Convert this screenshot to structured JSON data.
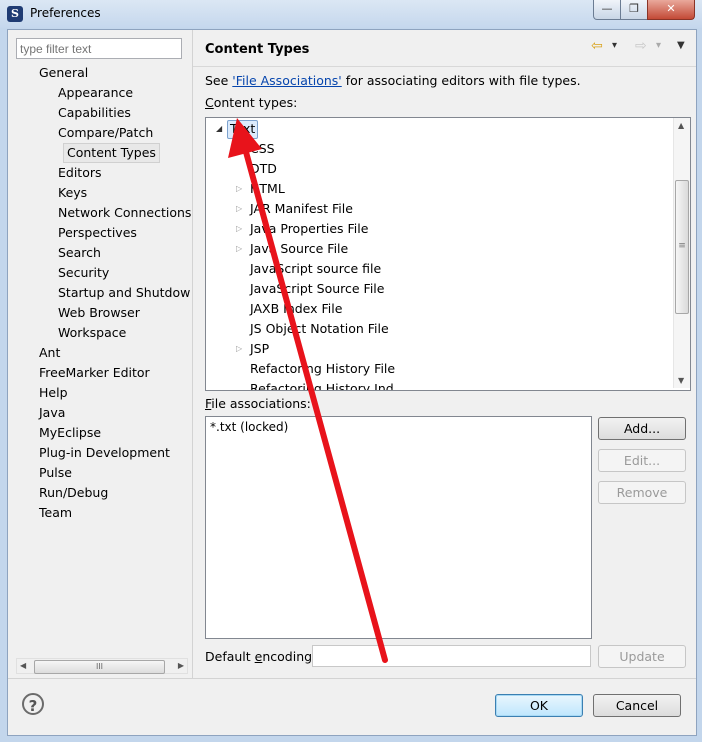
{
  "window": {
    "title": "Preferences",
    "min": "—",
    "max": "❐",
    "close": "✕",
    "app_icon": "S"
  },
  "filter": {
    "placeholder": "type filter text"
  },
  "nav_tree": [
    {
      "label": "General"
    },
    {
      "label": "Appearance"
    },
    {
      "label": "Capabilities"
    },
    {
      "label": "Compare/Patch"
    },
    {
      "label": "Content Types",
      "selected": true
    },
    {
      "label": "Editors"
    },
    {
      "label": "Keys"
    },
    {
      "label": "Network Connections"
    },
    {
      "label": "Perspectives"
    },
    {
      "label": "Search"
    },
    {
      "label": "Security"
    },
    {
      "label": "Startup and Shutdow"
    },
    {
      "label": "Web Browser"
    },
    {
      "label": "Workspace"
    },
    {
      "label": "Ant"
    },
    {
      "label": "FreeMarker Editor"
    },
    {
      "label": "Help"
    },
    {
      "label": "Java"
    },
    {
      "label": "MyEclipse"
    },
    {
      "label": "Plug-in Development"
    },
    {
      "label": "Pulse"
    },
    {
      "label": "Run/Debug"
    },
    {
      "label": "Team"
    }
  ],
  "hscroll_grip": "III",
  "page": {
    "title": "Content Types",
    "desc_prefix": "See ",
    "desc_link": "'File Associations'",
    "desc_suffix": " for associating editors with file types.",
    "content_types_label_u": "C",
    "content_types_label_rest": "ontent types:",
    "content_types": [
      {
        "label": "Text",
        "selected": true
      },
      {
        "label": "CSS"
      },
      {
        "label": "DTD"
      },
      {
        "label": "HTML"
      },
      {
        "label": "JAR Manifest File"
      },
      {
        "label": "Java Properties File"
      },
      {
        "label": "Java Source File"
      },
      {
        "label": "JavaScript source file"
      },
      {
        "label": "JavaScript Source File"
      },
      {
        "label": "JAXB Index File"
      },
      {
        "label": "JS Object Notation File"
      },
      {
        "label": "JSP"
      },
      {
        "label": "Refactoring History File"
      },
      {
        "label": "Refactoring History Ind"
      }
    ],
    "file_assoc_label_u": "F",
    "file_assoc_label_rest": "ile associations:",
    "file_associations": [
      "*.txt (locked)"
    ],
    "buttons": {
      "add": "Add...",
      "edit": "Edit...",
      "remove": "Remove",
      "update": "Update"
    },
    "encoding_label_a": "Default ",
    "encoding_label_u": "e",
    "encoding_label_b": "ncoding:",
    "encoding_value": ""
  },
  "nav_tools": {
    "back": "⇦",
    "forward": "⇨",
    "menu": "▾",
    "view_menu": "▼"
  },
  "dialog": {
    "help": "?",
    "ok": "OK",
    "cancel": "Cancel"
  },
  "colors": {
    "annotation_arrow": "#e8131b",
    "link": "#0645ad"
  }
}
